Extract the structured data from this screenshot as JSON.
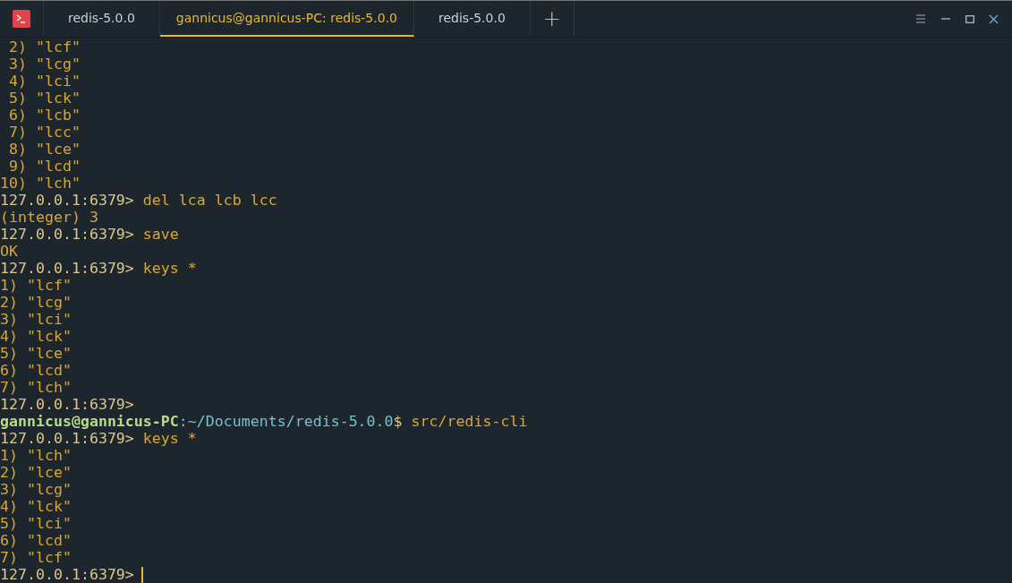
{
  "tabs": [
    {
      "label": "redis-5.0.0",
      "selected": false
    },
    {
      "label": "gannicus@gannicus-PC: redis-5.0.0",
      "selected": true
    },
    {
      "label": "redis-5.0.0",
      "selected": false
    }
  ],
  "add_tab": "+",
  "terminal": {
    "lines": [
      [
        {
          "kind": "output",
          "text": " 2) \"lcf\""
        }
      ],
      [
        {
          "kind": "output",
          "text": " 3) \"lcg\""
        }
      ],
      [
        {
          "kind": "output",
          "text": " 4) \"lci\""
        }
      ],
      [
        {
          "kind": "output",
          "text": " 5) \"lck\""
        }
      ],
      [
        {
          "kind": "output",
          "text": " 6) \"lcb\""
        }
      ],
      [
        {
          "kind": "output",
          "text": " 7) \"lcc\""
        }
      ],
      [
        {
          "kind": "output",
          "text": " 8) \"lce\""
        }
      ],
      [
        {
          "kind": "output",
          "text": " 9) \"lcd\""
        }
      ],
      [
        {
          "kind": "output",
          "text": "10) \"lch\""
        }
      ],
      [
        {
          "kind": "prompt",
          "text": "127.0.0.1:6379>"
        },
        {
          "kind": "command",
          "text": "del lca lcb lcc"
        }
      ],
      [
        {
          "kind": "output",
          "text": "(integer) 3"
        }
      ],
      [
        {
          "kind": "prompt",
          "text": "127.0.0.1:6379>"
        },
        {
          "kind": "command",
          "text": "save"
        }
      ],
      [
        {
          "kind": "output",
          "text": "OK"
        }
      ],
      [
        {
          "kind": "prompt",
          "text": "127.0.0.1:6379>"
        },
        {
          "kind": "command",
          "text": "keys *"
        }
      ],
      [
        {
          "kind": "output",
          "text": "1) \"lcf\""
        }
      ],
      [
        {
          "kind": "output",
          "text": "2) \"lcg\""
        }
      ],
      [
        {
          "kind": "output",
          "text": "3) \"lci\""
        }
      ],
      [
        {
          "kind": "output",
          "text": "4) \"lck\""
        }
      ],
      [
        {
          "kind": "output",
          "text": "5) \"lce\""
        }
      ],
      [
        {
          "kind": "output",
          "text": "6) \"lcd\""
        }
      ],
      [
        {
          "kind": "output",
          "text": "7) \"lch\""
        }
      ],
      [
        {
          "kind": "prompt",
          "text": "127.0.0.1:6379>"
        }
      ],
      [
        {
          "kind": "user",
          "text": "gannicus@gannicus-PC"
        },
        {
          "kind": "path",
          "text": ":~/Documents/redis-5.0.0"
        },
        {
          "kind": "dollar",
          "text": "$"
        },
        {
          "kind": "command",
          "text": "src/redis-cli"
        }
      ],
      [
        {
          "kind": "prompt",
          "text": "127.0.0.1:6379>"
        },
        {
          "kind": "command",
          "text": "keys *"
        }
      ],
      [
        {
          "kind": "output",
          "text": "1) \"lch\""
        }
      ],
      [
        {
          "kind": "output",
          "text": "2) \"lce\""
        }
      ],
      [
        {
          "kind": "output",
          "text": "3) \"lcg\""
        }
      ],
      [
        {
          "kind": "output",
          "text": "4) \"lck\""
        }
      ],
      [
        {
          "kind": "output",
          "text": "5) \"lci\""
        }
      ],
      [
        {
          "kind": "output",
          "text": "6) \"lcd\""
        }
      ],
      [
        {
          "kind": "output",
          "text": "7) \"lcf\""
        }
      ],
      [
        {
          "kind": "prompt",
          "text": "127.0.0.1:6379>"
        },
        {
          "kind": "cursor"
        }
      ]
    ]
  }
}
